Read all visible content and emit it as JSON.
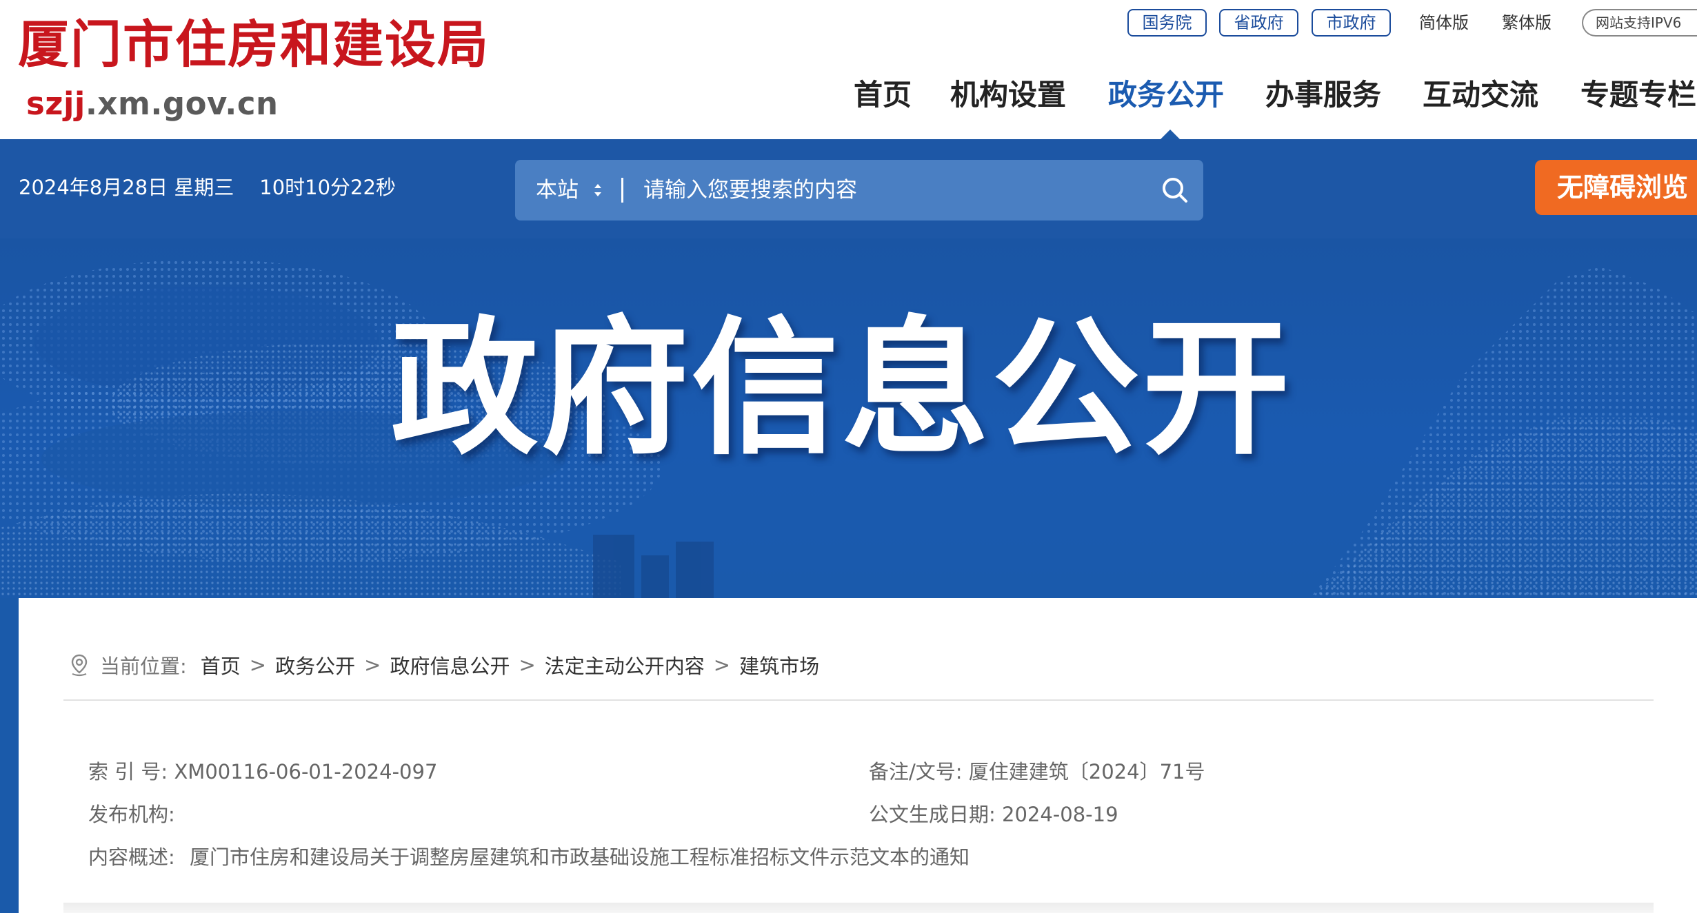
{
  "header": {
    "logo_cn": "厦门市住房和建设局",
    "logo_url_prefix": "szjj",
    "logo_url_rest": ".xm.gov.cn",
    "top_links": {
      "guowuyuan": "国务院",
      "shengzhengfu": "省政府",
      "shizhengfu": "市政府",
      "simplified": "简体版",
      "traditional": "繁体版",
      "ipv6": "网站支持IPV6"
    },
    "nav": {
      "home": "首页",
      "org": "机构设置",
      "gov_open": "政务公开",
      "service": "办事服务",
      "interact": "互动交流",
      "special": "专题专栏"
    },
    "active_nav": "政务公开"
  },
  "bluebar": {
    "date": "2024年8月28日 星期三    10时10分22秒",
    "search_scope": "本站",
    "search_placeholder": "请输入您要搜索的内容",
    "accessibility": "无障碍浏览"
  },
  "banner": {
    "title": "政府信息公开"
  },
  "breadcrumb": {
    "prefix": "当前位置:",
    "items": [
      "首页",
      "政务公开",
      "政府信息公开",
      "法定主动公开内容",
      "建筑市场"
    ],
    "separator": ">"
  },
  "document_meta": {
    "index_label": "索 引 号:",
    "index_value": "XM00116-06-01-2024-097",
    "docnum_label": "备注/文号:",
    "docnum_value": "厦住建建筑〔2024〕71号",
    "publisher_label": "发布机构:",
    "publisher_value": "",
    "date_label": "公文生成日期:",
    "date_value": "2024-08-19",
    "summary_label": "内容概述:",
    "summary_value": "厦门市住房和建设局关于调整房屋建筑和市政基础设施工程标准招标文件示范文本的通知"
  },
  "colors": {
    "brand_red": "#c8161d",
    "nav_blue": "#1b5bb0",
    "bar_blue": "#1d57a6",
    "search_bg": "#4a7fc3",
    "accessibility_orange": "#f06a22"
  }
}
